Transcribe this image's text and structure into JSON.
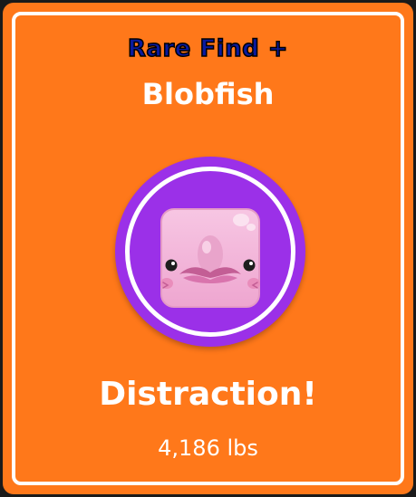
{
  "card": {
    "background_color": "#ff781a",
    "rarity_label": "Rare Find +",
    "rarity_color": "#0a1a9e",
    "fish_name": "Blobfish",
    "portrait_color": "#9b30e8",
    "portrait_icon": "blobfish-icon",
    "result_text": "Distraction!",
    "weight_text": "4,186 lbs"
  }
}
